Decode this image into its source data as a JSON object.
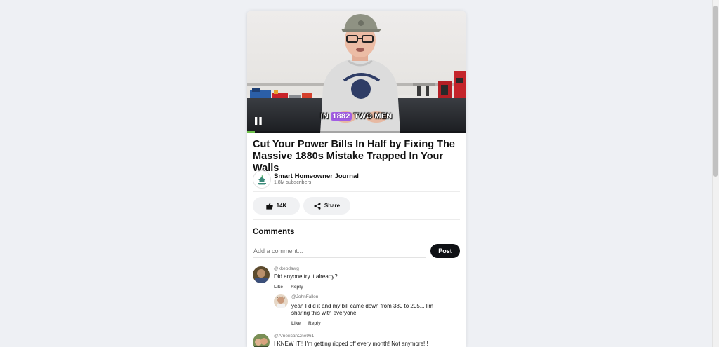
{
  "video": {
    "caption_prefix": "IN",
    "caption_highlight": "1882",
    "caption_suffix": "TWO MEN",
    "progress": 0.035,
    "state_icon": "pause-icon",
    "highlight_color": "#a25de3",
    "progress_color": "#6cc04a"
  },
  "post": {
    "title": "Cut Your Power Bills In Half by Fixing The Massive 1880s Mistake Trapped In Your Walls"
  },
  "channel": {
    "name": "Smart Homeowner Journal",
    "subscribers": "1.8M subscribers",
    "logo_icon": "house-leaf-logo"
  },
  "actions": {
    "like_count": "14K",
    "like_icon": "thumbs-up-icon",
    "share_label": "Share",
    "share_icon": "share-icon"
  },
  "comments": {
    "heading": "Comments",
    "input_placeholder": "Add a comment...",
    "post_label": "Post",
    "items": [
      {
        "user": "@kkepdawg",
        "text": "Did anyone try it already?",
        "like_label": "Like",
        "reply_label": "Reply",
        "replies": [
          {
            "user": "@JohnFallon",
            "text": "yeah I did it and my bill came down from 380 to 205... I'm sharing this with everyone",
            "like_label": "Like",
            "reply_label": "Reply"
          }
        ]
      },
      {
        "user": "@AmericanOne961",
        "text": "I KNEW IT!! I'm getting ripped off every month! Not anymore!!!"
      }
    ]
  }
}
